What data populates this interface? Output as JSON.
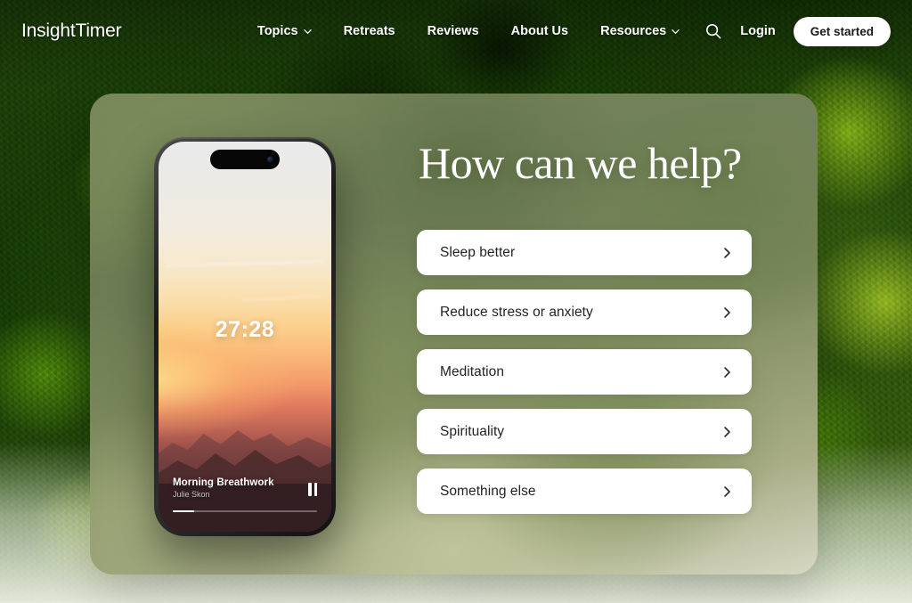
{
  "brand": {
    "logo_light": "Insight",
    "logo_bold": "Timer"
  },
  "nav": {
    "links": [
      {
        "label": "Topics",
        "has_chevron": true,
        "icon": "chevron-down-icon"
      },
      {
        "label": "Retreats",
        "has_chevron": false,
        "icon": ""
      },
      {
        "label": "Reviews",
        "has_chevron": false,
        "icon": ""
      },
      {
        "label": "About Us",
        "has_chevron": false,
        "icon": ""
      },
      {
        "label": "Resources",
        "has_chevron": true,
        "icon": "chevron-down-icon"
      }
    ],
    "search_icon": "search-icon",
    "login_label": "Login",
    "get_started_label": "Get started"
  },
  "hero": {
    "headline": "How can we help?",
    "options": [
      {
        "label": "Sleep better",
        "chevron": "chevron-right-icon"
      },
      {
        "label": "Reduce stress or anxiety",
        "chevron": "chevron-right-icon"
      },
      {
        "label": "Meditation",
        "chevron": "chevron-right-icon"
      },
      {
        "label": "Spirituality",
        "chevron": "chevron-right-icon"
      },
      {
        "label": "Something else",
        "chevron": "chevron-right-icon"
      }
    ]
  },
  "phone": {
    "timer": "27:28",
    "track_title": "Morning Breathwork",
    "track_artist": "Julie Skon",
    "transport_icon": "pause-icon",
    "progress_percent": 15
  },
  "colors": {
    "card_green": "#6b7a52",
    "option_card": "#ffffff",
    "option_text": "#242424",
    "accent_white": "#ffffff",
    "forest_dark": "#1e3a0e",
    "forest_light": "#b2cd3e"
  }
}
